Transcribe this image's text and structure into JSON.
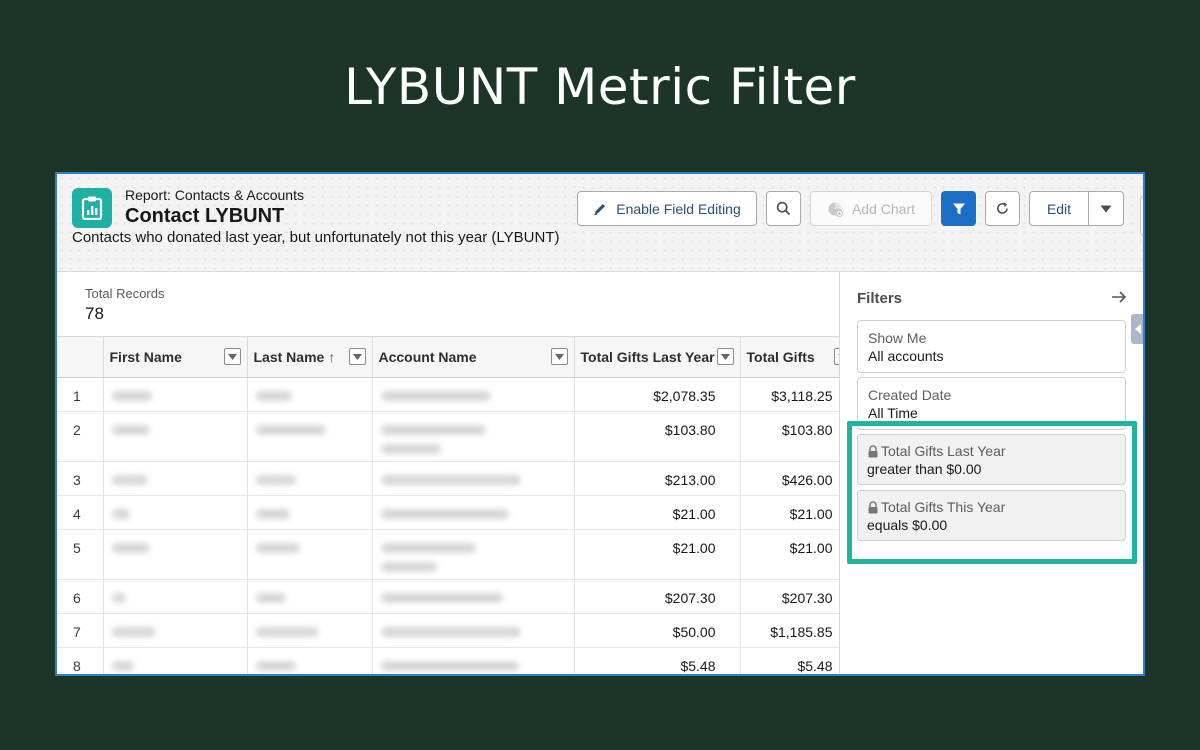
{
  "slide": {
    "title": "LYBUNT Metric Filter"
  },
  "report": {
    "type_label": "Report: Contacts & Accounts",
    "name": "Contact LYBUNT",
    "description": "Contacts who donated last year, but unfortunately not this year (LYBUNT)"
  },
  "toolbar": {
    "enable_field_editing": "Enable Field Editing",
    "add_chart": "Add Chart",
    "edit": "Edit"
  },
  "summary": {
    "label": "Total Records",
    "value": "78"
  },
  "table": {
    "columns": [
      "First Name",
      "Last Name",
      "Account Name",
      "Total Gifts Last Year",
      "Total Gifts"
    ],
    "sort_indicator": "↑",
    "rows": [
      {
        "idx": "1",
        "last_year": "$2,078.35",
        "total": "$3,118.25"
      },
      {
        "idx": "2",
        "last_year": "$103.80",
        "total": "$103.80"
      },
      {
        "idx": "3",
        "last_year": "$213.00",
        "total": "$426.00"
      },
      {
        "idx": "4",
        "last_year": "$21.00",
        "total": "$21.00"
      },
      {
        "idx": "5",
        "last_year": "$21.00",
        "total": "$21.00"
      },
      {
        "idx": "6",
        "last_year": "$207.30",
        "total": "$207.30"
      },
      {
        "idx": "7",
        "last_year": "$50.00",
        "total": "$1,185.85"
      },
      {
        "idx": "8",
        "last_year": "$5.48",
        "total": "$5.48"
      }
    ]
  },
  "filters": {
    "title": "Filters",
    "items": [
      {
        "label": "Show Me",
        "value": "All accounts",
        "locked": false
      },
      {
        "label": "Created Date",
        "value": "All Time",
        "locked": false
      },
      {
        "label": "Total Gifts Last Year",
        "value": "greater than $0.00",
        "locked": true
      },
      {
        "label": "Total Gifts This Year",
        "value": "equals $0.00",
        "locked": true
      }
    ]
  },
  "colors": {
    "background": "#1c3526",
    "frame_border": "#2f7fd9",
    "report_icon": "#1fb0a3",
    "brand_button": "#1b6fc6",
    "highlight": "#1fb5a0"
  },
  "icons": [
    "report-icon",
    "pencil-icon",
    "search-icon",
    "add-chart-icon",
    "filter-icon",
    "refresh-icon",
    "chevron-down-icon",
    "arrow-right-icon",
    "lock-icon",
    "column-dropdown-icon"
  ]
}
